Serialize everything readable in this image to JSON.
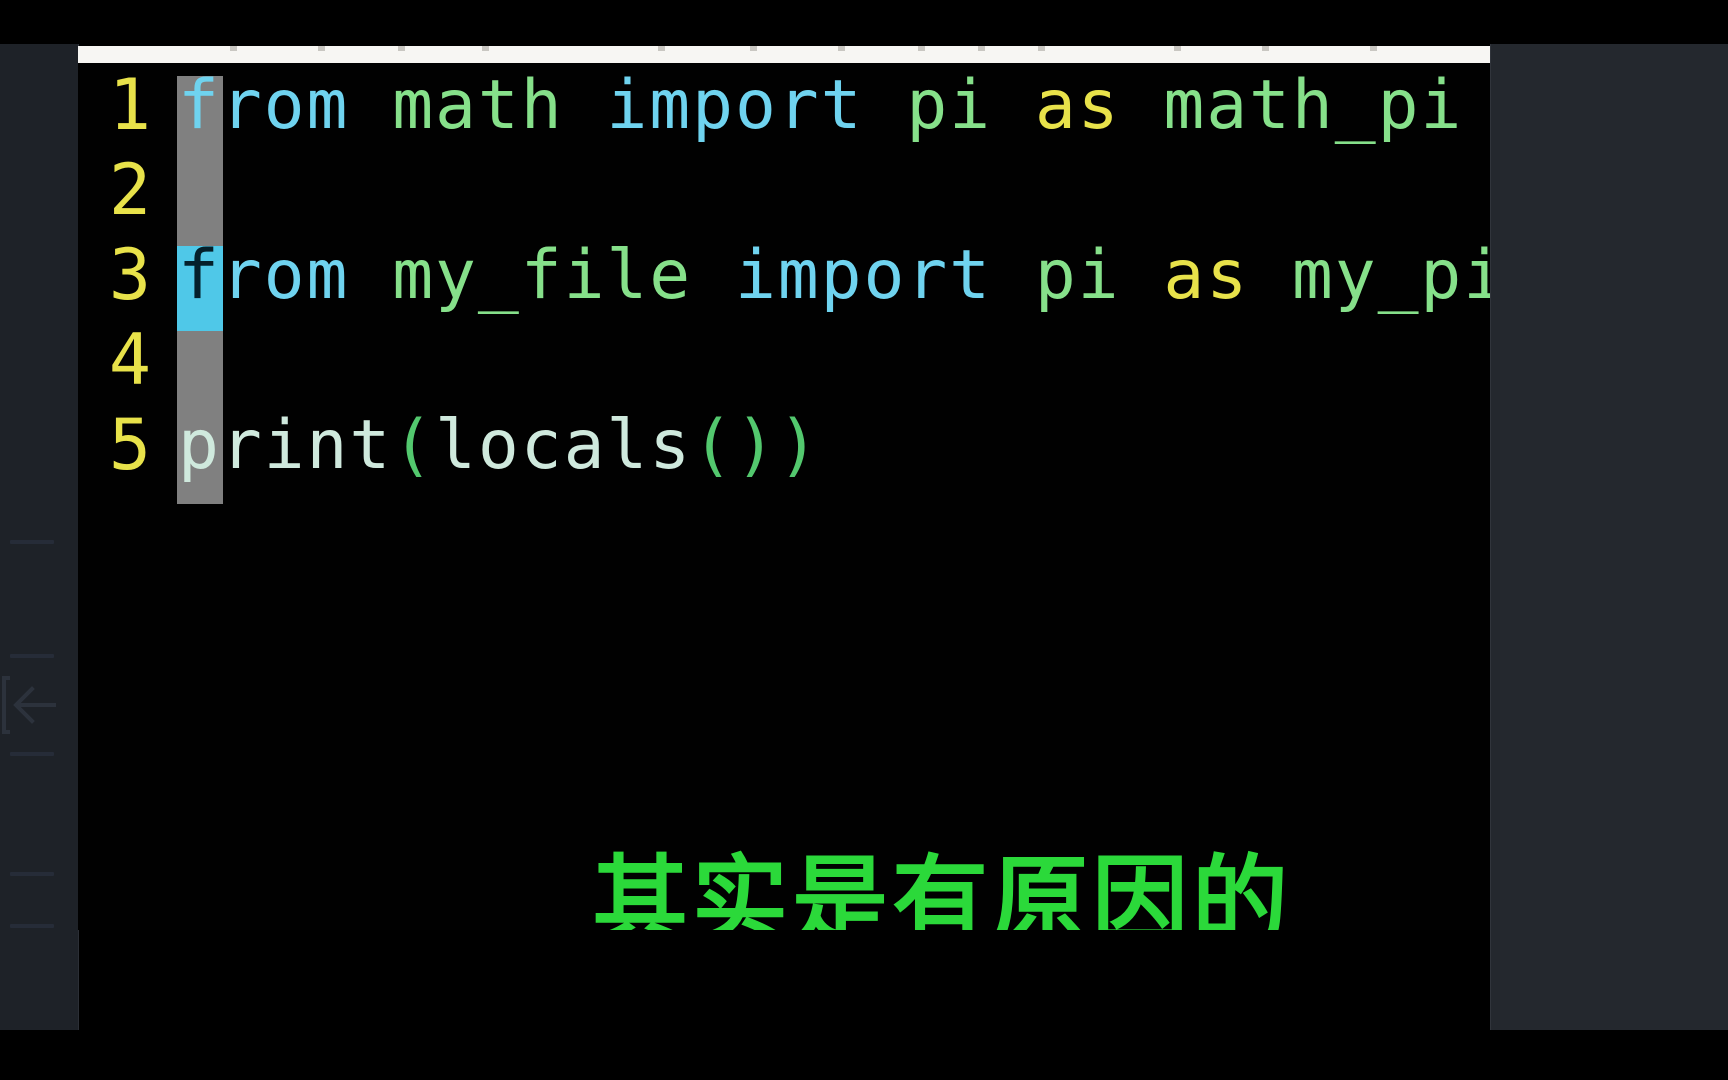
{
  "window": {
    "app_kind": "code-editor",
    "colors": {
      "editor_background": "#010101",
      "gutter_line_number": "#e8e24a",
      "keyword": "#6fd3ef",
      "identifier": "#86e08a",
      "as_keyword": "#e8e24a",
      "function_name": "#cfe9dd",
      "parenthesis": "#53c86e",
      "cursor_block": "#4fc8e8",
      "column_highlight": "#808080",
      "sidebar_background": "#1e2228",
      "right_panel_background": "#24282e",
      "breadcrumb_strip": "#f7f6f3",
      "subtitle_green": "#2bd93a"
    }
  },
  "sidebar": {
    "collapse_icon": "collapse-panel-arrow-icon",
    "ticks": [
      "",
      "",
      "",
      "",
      ""
    ]
  },
  "editor": {
    "cursor": {
      "line": 3,
      "column": 1,
      "glyph": "f"
    },
    "column_guide": {
      "from_line": 1,
      "to_line": 5,
      "column": 1
    },
    "lines": [
      {
        "number": "1",
        "tokens": [
          {
            "text": "f",
            "kind": "keyword-on-guide"
          },
          {
            "text": "rom",
            "kind": "keyword"
          },
          {
            "text": " ",
            "kind": "plain"
          },
          {
            "text": "math",
            "kind": "identifier"
          },
          {
            "text": " ",
            "kind": "plain"
          },
          {
            "text": "import",
            "kind": "keyword"
          },
          {
            "text": " ",
            "kind": "plain"
          },
          {
            "text": "pi",
            "kind": "identifier"
          },
          {
            "text": " ",
            "kind": "plain"
          },
          {
            "text": "as",
            "kind": "as-keyword"
          },
          {
            "text": " ",
            "kind": "plain"
          },
          {
            "text": "math_pi",
            "kind": "identifier"
          }
        ],
        "plain": "from math import pi as math_pi"
      },
      {
        "number": "2",
        "tokens": [],
        "plain": ""
      },
      {
        "number": "3",
        "tokens": [
          {
            "text": "f",
            "kind": "on-cursor"
          },
          {
            "text": "rom",
            "kind": "keyword"
          },
          {
            "text": " ",
            "kind": "plain"
          },
          {
            "text": "my_file",
            "kind": "identifier"
          },
          {
            "text": " ",
            "kind": "plain"
          },
          {
            "text": "import",
            "kind": "keyword"
          },
          {
            "text": " ",
            "kind": "plain"
          },
          {
            "text": "pi",
            "kind": "identifier"
          },
          {
            "text": " ",
            "kind": "plain"
          },
          {
            "text": "as",
            "kind": "as-keyword"
          },
          {
            "text": " ",
            "kind": "plain"
          },
          {
            "text": "my_pi",
            "kind": "identifier"
          }
        ],
        "plain": "from my_file import pi as my_pi"
      },
      {
        "number": "4",
        "tokens": [],
        "plain": ""
      },
      {
        "number": "5",
        "tokens": [
          {
            "text": "print",
            "kind": "function"
          },
          {
            "text": "(",
            "kind": "paren"
          },
          {
            "text": "locals",
            "kind": "function"
          },
          {
            "text": "(",
            "kind": "paren"
          },
          {
            "text": ")",
            "kind": "paren"
          },
          {
            "text": ")",
            "kind": "paren"
          }
        ],
        "plain": "print(locals())"
      }
    ]
  },
  "subtitle": {
    "text": "其实是有原因的"
  }
}
